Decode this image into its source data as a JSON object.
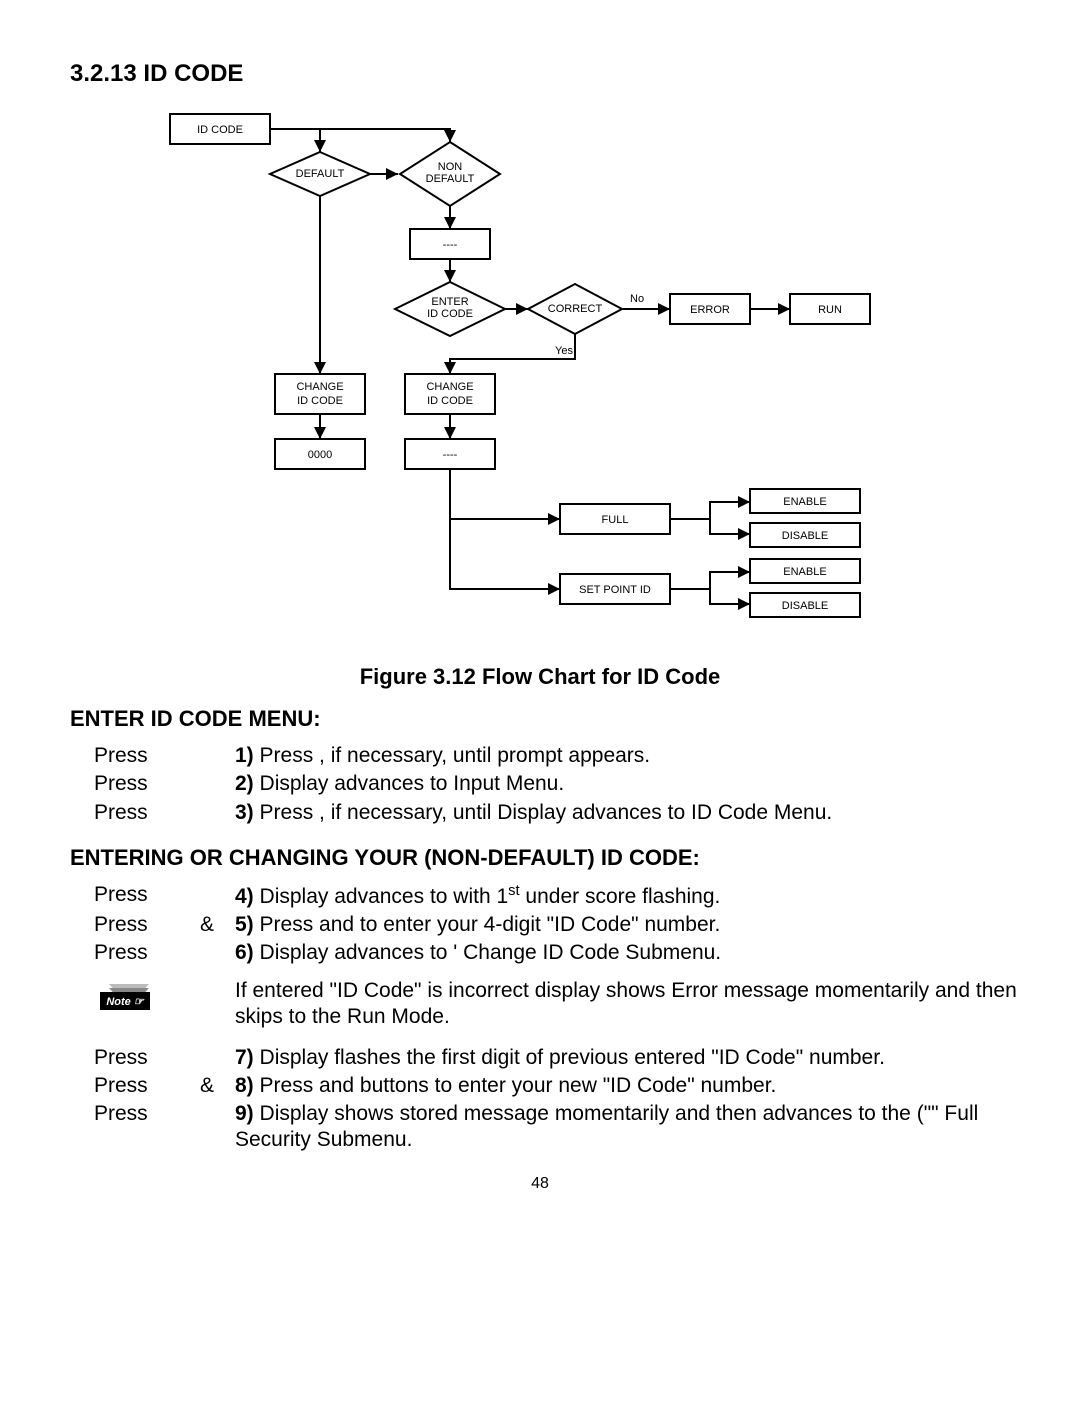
{
  "heading": "3.2.13 ID CODE",
  "figure_caption": "Figure 3.12 Flow Chart for ID Code",
  "page_number": "48",
  "diagram": {
    "id_code": "ID CODE",
    "default": "DEFAULT",
    "non_default1": "NON",
    "non_default2": "DEFAULT",
    "dashes": "----",
    "enter_code1": "ENTER",
    "enter_code2": "ID CODE",
    "correct": "CORRECT",
    "no": "No",
    "yes": "Yes",
    "error": "ERROR",
    "run": "RUN",
    "change_id1": "CHANGE",
    "change_id2": "ID CODE",
    "zeros": "0000",
    "full": "FULL",
    "set_point_id": "SET POINT ID",
    "enable": "ENABLE",
    "disable": "DISABLE"
  },
  "sections": {
    "enter_menu_title": "ENTER ID CODE MENU:",
    "changing_title": "ENTERING OR CHANGING YOUR (NON-DEFAULT) ID CODE:",
    "note_label": "Note ☞"
  },
  "rows": {
    "r1_c1": "Press",
    "r1_text": " Press     , if necessary, until                 prompt appears.",
    "r2_c1": "Press",
    "r2_text": " Display advances to               Input Menu.",
    "r3_c1": "Press",
    "r3_text": " Press     , if necessary, until Display advances to          ID Code Menu.",
    "r4_c1": "Press",
    "r4_textA": " Display advances to               with 1",
    "r4_textB": " under score flashing.",
    "r4_sup": "st",
    "r5_c1": "Press",
    "r5_c2": "&",
    "r5_text": " Press      and       to enter your 4-digit \"ID Code\" number.",
    "r6_c1": "Press",
    "r6_text": " Display advances to   '          Change ID Code Submenu.",
    "note_text": "If  entered \"ID Code\" is incorrect display shows                Error message momentarily and then skips to the Run Mode.",
    "r7_c1": "Press",
    "r7_text": " Display flashes the first digit of previous entered \"ID Code\" number.",
    "r8_c1": "Press",
    "r8_c2": "&",
    "r8_text": " Press      and         buttons to enter your new \"ID Code\" number.",
    "r9_c1": "Press",
    "r9_text": " Display shows                 stored message momentarily and then advances to the  (\"\"       Full Security Submenu."
  },
  "chart_data": {
    "type": "flowchart",
    "nodes": [
      {
        "id": "idcode",
        "label": "ID CODE",
        "shape": "rect"
      },
      {
        "id": "default",
        "label": "DEFAULT",
        "shape": "diamond"
      },
      {
        "id": "nondefault",
        "label": "NON DEFAULT",
        "shape": "diamond"
      },
      {
        "id": "dashesA",
        "label": "----",
        "shape": "rect"
      },
      {
        "id": "enter_id",
        "label": "ENTER ID CODE",
        "shape": "diamond"
      },
      {
        "id": "correct",
        "label": "CORRECT",
        "shape": "diamond"
      },
      {
        "id": "error",
        "label": "ERROR",
        "shape": "rect"
      },
      {
        "id": "run",
        "label": "RUN",
        "shape": "rect"
      },
      {
        "id": "change_a",
        "label": "CHANGE ID CODE",
        "shape": "rect"
      },
      {
        "id": "change_b",
        "label": "CHANGE ID CODE",
        "shape": "rect"
      },
      {
        "id": "zeros",
        "label": "0000",
        "shape": "rect"
      },
      {
        "id": "dashesB",
        "label": "----",
        "shape": "rect"
      },
      {
        "id": "full",
        "label": "FULL",
        "shape": "rect"
      },
      {
        "id": "setpoint",
        "label": "SET POINT ID",
        "shape": "rect"
      },
      {
        "id": "full_enable",
        "label": "ENABLE",
        "shape": "rect"
      },
      {
        "id": "full_disable",
        "label": "DISABLE",
        "shape": "rect"
      },
      {
        "id": "sp_enable",
        "label": "ENABLE",
        "shape": "rect"
      },
      {
        "id": "sp_disable",
        "label": "DISABLE",
        "shape": "rect"
      }
    ],
    "edges": [
      {
        "from": "idcode",
        "to": "default"
      },
      {
        "from": "idcode",
        "to": "nondefault"
      },
      {
        "from": "default",
        "to": "nondefault"
      },
      {
        "from": "nondefault",
        "to": "dashesA"
      },
      {
        "from": "dashesA",
        "to": "enter_id"
      },
      {
        "from": "enter_id",
        "to": "correct"
      },
      {
        "from": "correct",
        "to": "error",
        "label": "No"
      },
      {
        "from": "error",
        "to": "run"
      },
      {
        "from": "correct",
        "to": "change_b",
        "label": "Yes"
      },
      {
        "from": "default",
        "to": "change_a"
      },
      {
        "from": "change_a",
        "to": "zeros"
      },
      {
        "from": "change_b",
        "to": "dashesB"
      },
      {
        "from": "dashesB",
        "to": "full"
      },
      {
        "from": "dashesB",
        "to": "setpoint"
      },
      {
        "from": "full",
        "to": "full_enable"
      },
      {
        "from": "full",
        "to": "full_disable"
      },
      {
        "from": "setpoint",
        "to": "sp_enable"
      },
      {
        "from": "setpoint",
        "to": "sp_disable"
      }
    ]
  }
}
